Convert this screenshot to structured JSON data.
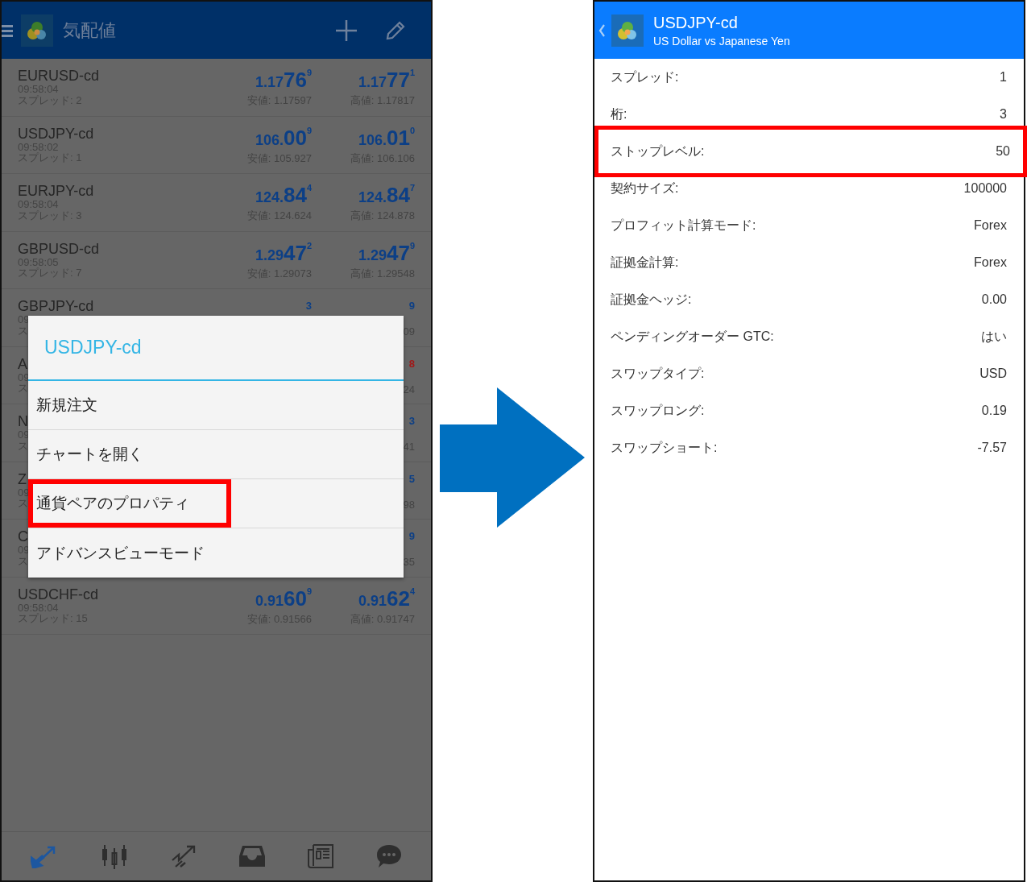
{
  "quotes_screen": {
    "title": "気配値",
    "rows": [
      {
        "kind": "full",
        "name": "EURUSD-cd",
        "time": "09:58:04",
        "spread": "スプレッド: 2",
        "bid": {
          "prefix": "1.17",
          "big": "76",
          "sup": "9"
        },
        "bid_low": "安値: 1.17597",
        "ask": {
          "prefix": "1.17",
          "big": "77",
          "sup": "1"
        },
        "ask_high": "高値: 1.17817"
      },
      {
        "kind": "full",
        "name": "USDJPY-cd",
        "time": "09:58:02",
        "spread": "スプレッド: 1",
        "bid": {
          "prefix": "106.",
          "big": "00",
          "sup": "9"
        },
        "bid_low": "安値: 105.927",
        "ask": {
          "prefix": "106.",
          "big": "01",
          "sup": "0"
        },
        "ask_high": "高値: 106.106"
      },
      {
        "kind": "full",
        "name": "EURJPY-cd",
        "time": "09:58:04",
        "spread": "スプレッド: 3",
        "bid": {
          "prefix": "124.",
          "big": "84",
          "sup": "4"
        },
        "bid_low": "安値: 124.624",
        "ask": {
          "prefix": "124.",
          "big": "84",
          "sup": "7"
        },
        "ask_high": "高値: 124.878"
      },
      {
        "kind": "full",
        "name": "GBPUSD-cd",
        "time": "09:58:05",
        "spread": "スプレッド: 7",
        "bid": {
          "prefix": "1.29",
          "big": "47",
          "sup": "2"
        },
        "bid_low": "安値: 1.29073",
        "ask": {
          "prefix": "1.29",
          "big": "47",
          "sup": "9"
        },
        "ask_high": "高値: 1.29548"
      },
      {
        "kind": "partial",
        "name": "GBPJPY-cd",
        "time": "09",
        "spread": "ス",
        "bid_sup": "3",
        "ask_sup": "9",
        "ask_high": "09",
        "color": "#0c3f86"
      },
      {
        "kind": "partial",
        "name": "A",
        "time": "09",
        "spread": "ス",
        "ask_sup": "8",
        "ask_high": "24",
        "color": "#a01818"
      },
      {
        "kind": "partial",
        "name": "N",
        "time": "09",
        "spread": "ス",
        "ask_sup": "3",
        "ask_high": "41",
        "color": "#0c3f86"
      },
      {
        "kind": "partial",
        "name": "Z",
        "time": "09",
        "spread": "ス",
        "ask_sup": "5",
        "ask_high": "98",
        "color": "#0c3f86"
      },
      {
        "kind": "partial",
        "name": "C",
        "time": "09",
        "spread": "ス",
        "ask_sup": "9",
        "ask_high": "35",
        "color": "#0c3f86"
      },
      {
        "kind": "full",
        "name": "USDCHF-cd",
        "time": "09:58:04",
        "spread": "スプレッド: 15",
        "bid": {
          "prefix": "0.91",
          "big": "60",
          "sup": "9"
        },
        "bid_low": "安値: 0.91566",
        "ask": {
          "prefix": "0.91",
          "big": "62",
          "sup": "4"
        },
        "ask_high": "高値: 0.91747"
      }
    ],
    "dialog": {
      "title": "USDJPY-cd",
      "items": [
        {
          "label": "新規注文",
          "highlighted": false
        },
        {
          "label": "チャートを開く",
          "highlighted": false
        },
        {
          "label": "通貨ペアのプロパティ",
          "highlighted": true
        },
        {
          "label": "アドバンスビューモード",
          "highlighted": false
        }
      ]
    },
    "bottom_nav": [
      {
        "selected": true
      },
      {
        "selected": false
      },
      {
        "selected": false
      },
      {
        "selected": false
      },
      {
        "selected": false
      },
      {
        "selected": false
      }
    ]
  },
  "properties_screen": {
    "title": "USDJPY-cd",
    "subtitle": "US Dollar vs Japanese Yen",
    "rows": [
      {
        "label": "スプレッド:",
        "value": "1",
        "highlighted": false
      },
      {
        "label": "桁:",
        "value": "3",
        "highlighted": false
      },
      {
        "label": "ストップレベル:",
        "value": "50",
        "highlighted": true
      },
      {
        "label": "契約サイズ:",
        "value": "100000",
        "highlighted": false
      },
      {
        "label": "プロフィット計算モード:",
        "value": "Forex",
        "highlighted": false
      },
      {
        "label": "証拠金計算:",
        "value": "Forex",
        "highlighted": false
      },
      {
        "label": "証拠金ヘッジ:",
        "value": "0.00",
        "highlighted": false
      },
      {
        "label": "ペンディングオーダー GTC:",
        "value": "はい",
        "highlighted": false
      },
      {
        "label": "スワップタイプ:",
        "value": "USD",
        "highlighted": false
      },
      {
        "label": "スワップロング:",
        "value": "0.19",
        "highlighted": false
      },
      {
        "label": "スワップショート:",
        "value": "-7.57",
        "highlighted": false
      }
    ]
  }
}
